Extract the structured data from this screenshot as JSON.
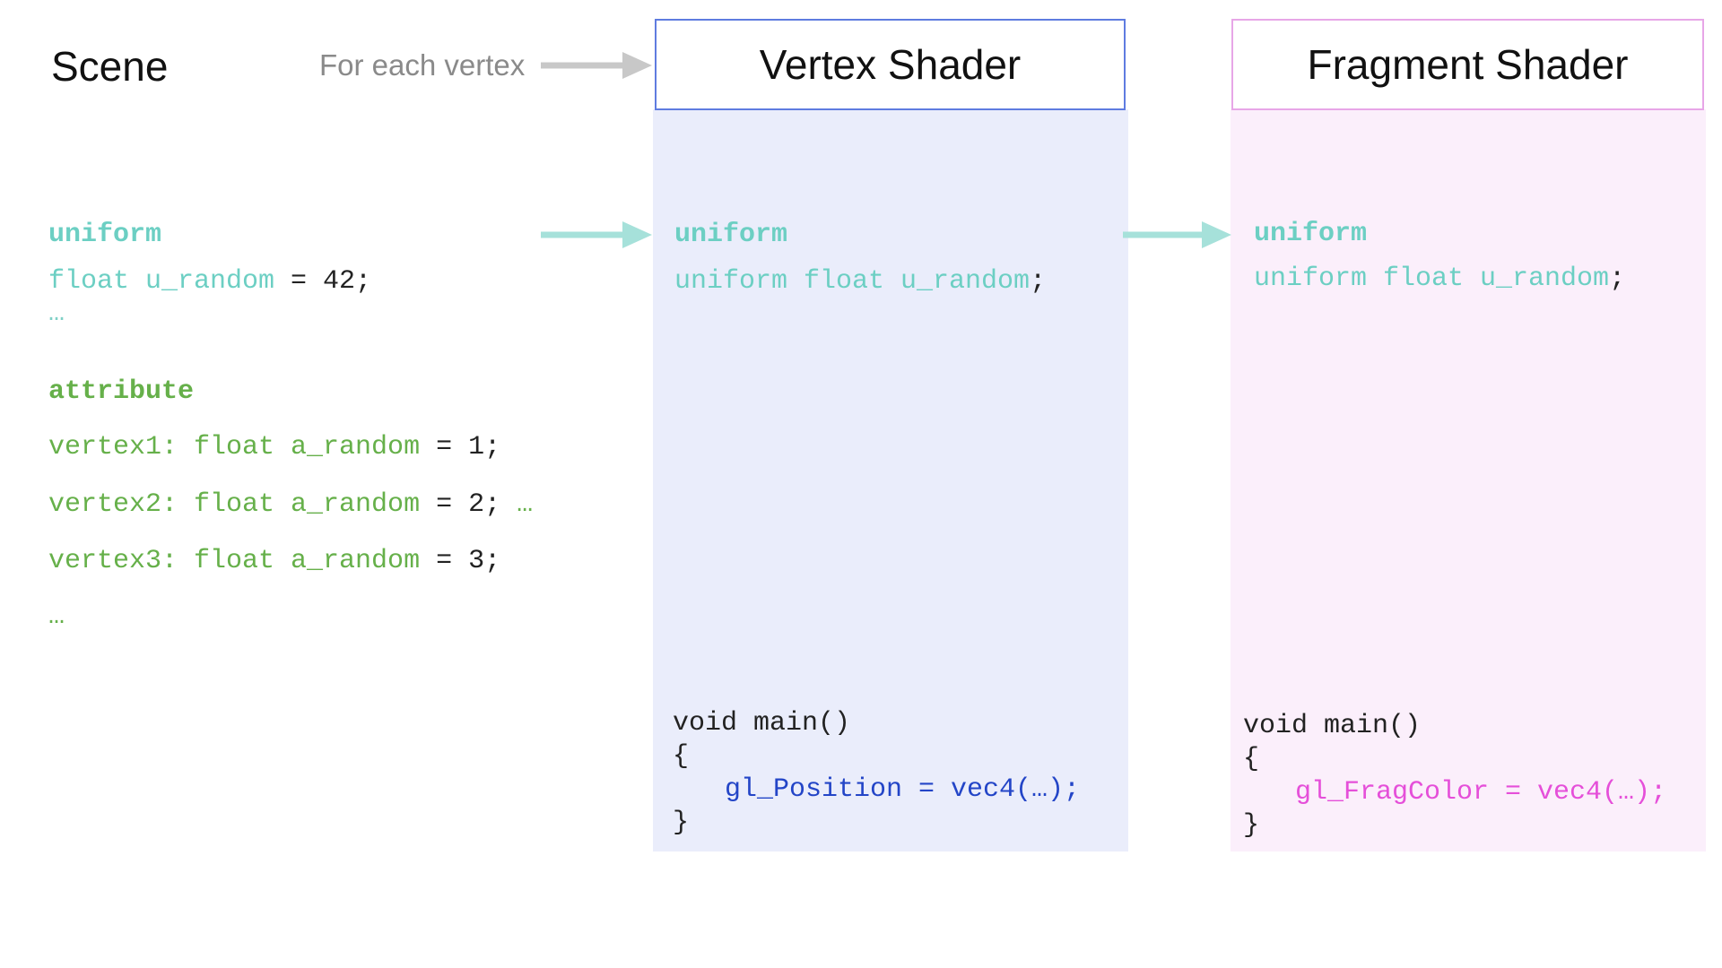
{
  "scene": {
    "title": "Scene",
    "for_each_label": "For each vertex",
    "uniform_keyword": "uniform",
    "uniform_decl": "float u_random",
    "uniform_value": " = 42;",
    "uniform_ellipsis": "…",
    "attribute_keyword": "attribute",
    "attributes": [
      {
        "decl": "vertex1: float a_random",
        "value": " = 1;",
        "extra": ""
      },
      {
        "decl": "vertex2: float a_random",
        "value": " = 2;",
        "extra": " …"
      },
      {
        "decl": "vertex3: float a_random",
        "value": " = 3;",
        "extra": ""
      }
    ],
    "attribute_ellipsis": "…"
  },
  "vertex_shader": {
    "title": "Vertex Shader",
    "uniform_keyword": "uniform",
    "uniform_decl": "uniform float u_random",
    "semicolon": ";",
    "main_signature": "void main()",
    "open_brace": "{",
    "body": "gl_Position = vec4(…);",
    "close_brace": "}"
  },
  "fragment_shader": {
    "title": "Fragment Shader",
    "uniform_keyword": "uniform",
    "uniform_decl": "uniform float u_random",
    "semicolon": ";",
    "main_signature": "void main()",
    "open_brace": "{",
    "body": "gl_FragColor = vec4(…);",
    "close_brace": "}"
  },
  "colors": {
    "uniform": "#6ccfc3",
    "attribute": "#66b04a",
    "vertex_accent": "#2345c7",
    "fragment_accent": "#e54fd9",
    "vertex_panel": "#eaedfb",
    "fragment_panel": "#fbeffb",
    "arrow_gray": "#c8c8c8",
    "arrow_teal": "#a6e1da"
  }
}
